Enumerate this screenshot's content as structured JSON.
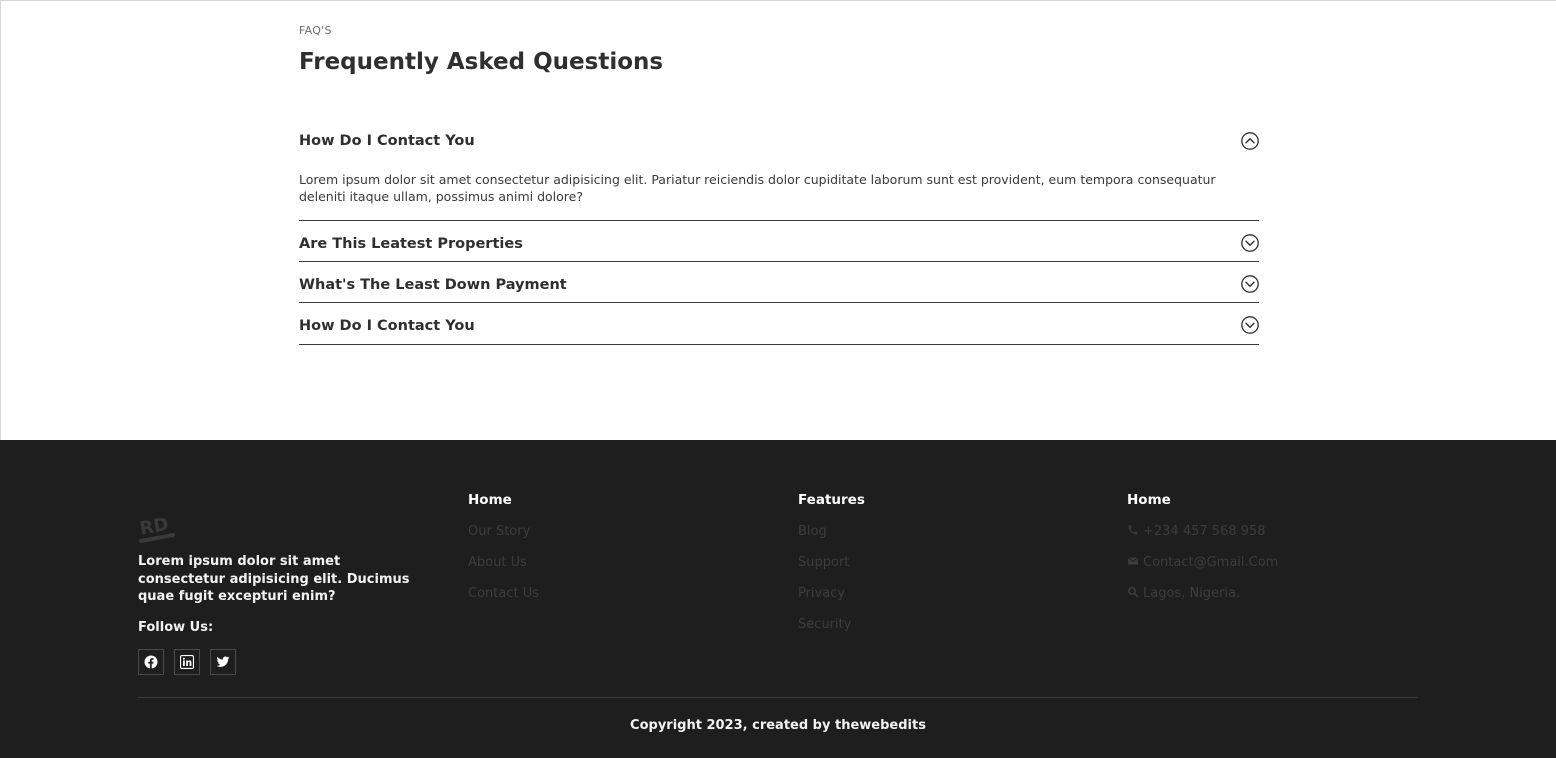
{
  "faq": {
    "eyebrow": "FAQ'S",
    "title": "Frequently Asked Questions",
    "items": [
      {
        "question": "How Do I Contact You",
        "expanded": true,
        "icon": "chevron-up-circle-icon",
        "answer": "Lorem ipsum dolor sit amet consectetur adipisicing elit. Pariatur reiciendis dolor cupiditate laborum sunt est provident, eum tempora consequatur deleniti itaque ullam, possimus animi dolore?"
      },
      {
        "question": "Are This Leatest Properties",
        "expanded": false,
        "icon": "chevron-down-circle-icon"
      },
      {
        "question": "What's The Least Down Payment",
        "expanded": false,
        "icon": "chevron-down-circle-icon"
      },
      {
        "question": "How Do I Contact You",
        "expanded": false,
        "icon": "chevron-down-circle-icon"
      }
    ]
  },
  "footer": {
    "logo_text": "RD",
    "description": "Lorem ipsum dolor sit amet consectetur adipisicing elit. Ducimus quae fugit excepturi enim?",
    "follow_label": "Follow Us:",
    "socials": [
      "facebook-icon",
      "linkedin-icon",
      "twitter-icon"
    ],
    "columns": [
      {
        "title": "Home",
        "links": [
          "Our Story",
          "About Us",
          "Contact Us"
        ]
      },
      {
        "title": "Features",
        "links": [
          "Blog",
          "Support",
          "Privacy",
          "Security"
        ]
      },
      {
        "title": "Home",
        "contacts": [
          {
            "icon": "phone-icon",
            "text": "+234 457 568 958"
          },
          {
            "icon": "envelope-icon",
            "text": "Contact@Gmail.Com"
          },
          {
            "icon": "search-icon",
            "text": "Lagos, Nigeria."
          }
        ]
      }
    ],
    "copyright": "Copyright 2023, created by thewebedits"
  },
  "colors": {
    "footer_bg": "#1e1e1e",
    "text_dark": "#2f2f2f",
    "footer_link_muted": "#3d3d3d"
  }
}
